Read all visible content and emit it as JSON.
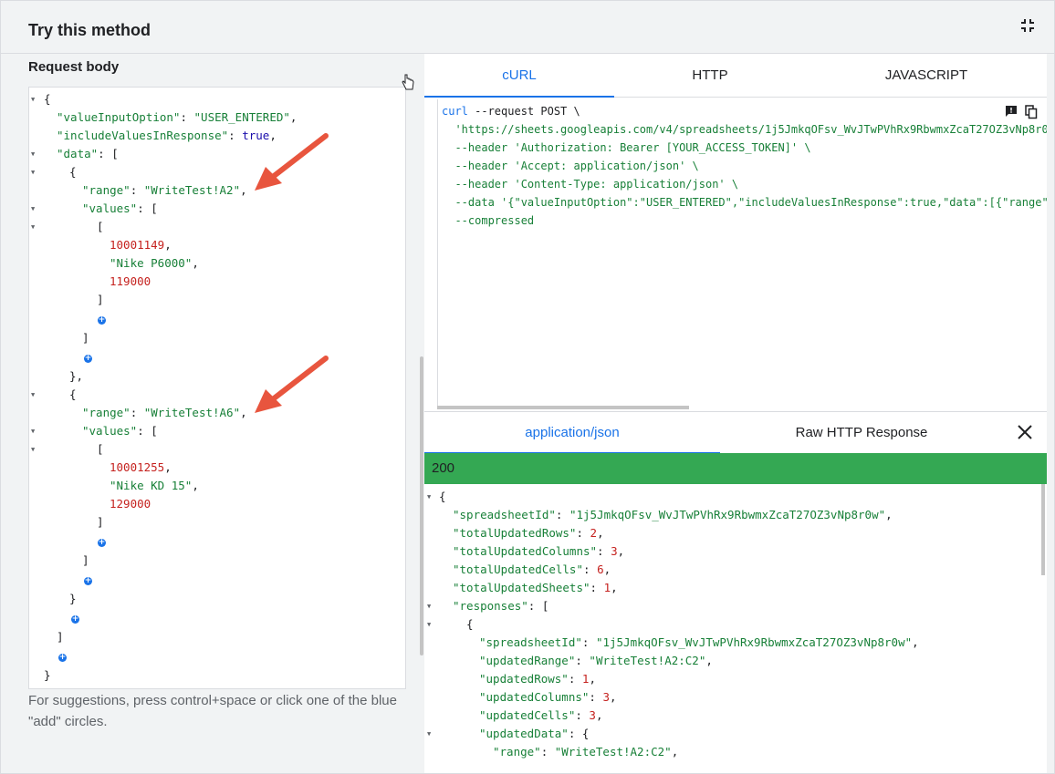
{
  "header": {
    "title": "Try this method"
  },
  "left": {
    "section_label": "Request body",
    "hint": "For suggestions, press control+space or click one of the blue \"add\" circles."
  },
  "request_body_lines": [
    "{",
    "\"valueInputOption\"",
    "\"USER_ENTERED\"",
    "\"includeValuesInResponse\"",
    "true",
    "\"data\"",
    "\"range\"",
    "\"WriteTest!A2\"",
    "\"values\"",
    "10001149",
    "\"Nike P6000\"",
    "119000",
    "\"range\"",
    "\"WriteTest!A6\"",
    "\"values\"",
    "10001255",
    "\"Nike KD 15\"",
    "129000"
  ],
  "tabs": {
    "curl": "cURL",
    "http": "HTTP",
    "javascript": "JAVASCRIPT"
  },
  "curl": {
    "l1_cmd": "curl",
    "l1_rest": " --request POST \\",
    "l2": "  'https://sheets.googleapis.com/v4/spreadsheets/1j5JmkqOFsv_WvJTwPVhRx9RbwmxZcaT27OZ3vNp8r0",
    "l3": "  --header 'Authorization: Bearer [YOUR_ACCESS_TOKEN]' \\",
    "l4": "  --header 'Accept: application/json' \\",
    "l5": "  --header 'Content-Type: application/json' \\",
    "l6": "  --data '{\"valueInputOption\":\"USER_ENTERED\",\"includeValuesInResponse\":true,\"data\":[{\"range\"",
    "l7": "  --compressed"
  },
  "response": {
    "tab_json": "application/json",
    "tab_raw": "Raw HTTP Response",
    "status": "200",
    "spreadsheetId_key": "\"spreadsheetId\"",
    "spreadsheetId_val": "\"1j5JmkqOFsv_WvJTwPVhRx9RbwmxZcaT27OZ3vNp8r0w\"",
    "totalUpdatedRows_key": "\"totalUpdatedRows\"",
    "totalUpdatedRows_val": "2",
    "totalUpdatedColumns_key": "\"totalUpdatedColumns\"",
    "totalUpdatedColumns_val": "3",
    "totalUpdatedCells_key": "\"totalUpdatedCells\"",
    "totalUpdatedCells_val": "6",
    "totalUpdatedSheets_key": "\"totalUpdatedSheets\"",
    "totalUpdatedSheets_val": "1",
    "responses_key": "\"responses\"",
    "r_spreadsheetId_key": "\"spreadsheetId\"",
    "r_spreadsheetId_val": "\"1j5JmkqOFsv_WvJTwPVhRx9RbwmxZcaT27OZ3vNp8r0w\"",
    "updatedRange_key": "\"updatedRange\"",
    "updatedRange_val": "\"WriteTest!A2:C2\"",
    "updatedRows_key": "\"updatedRows\"",
    "updatedRows_val": "1",
    "updatedColumns_key": "\"updatedColumns\"",
    "updatedColumns_val": "3",
    "updatedCells_key": "\"updatedCells\"",
    "updatedCells_val": "3",
    "updatedData_key": "\"updatedData\"",
    "range_key": "\"range\"",
    "range_val": "\"WriteTest!A2:C2\""
  },
  "colors": {
    "accent": "#1a73e8",
    "status": "#34a853",
    "annotation_arrow": "#e8553e"
  }
}
